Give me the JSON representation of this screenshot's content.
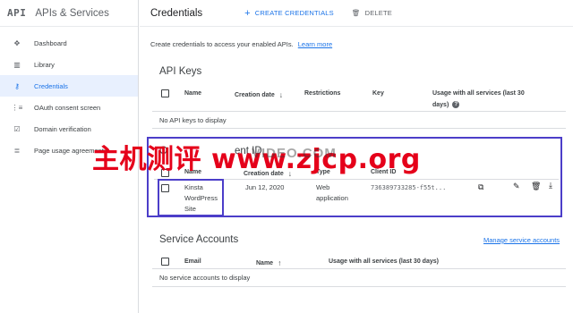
{
  "app": {
    "logo": "API",
    "title": "APIs & Services"
  },
  "sidebar": {
    "items": [
      {
        "label": "Dashboard",
        "icon": "diamond-dots-icon"
      },
      {
        "label": "Library",
        "icon": "library-grid-icon"
      },
      {
        "label": "Credentials",
        "icon": "key-icon",
        "active": true
      },
      {
        "label": "OAuth consent screen",
        "icon": "consent-list-icon"
      },
      {
        "label": "Domain verification",
        "icon": "checkbox-verify-icon"
      },
      {
        "label": "Page usage agreements",
        "icon": "settings-list-icon"
      }
    ]
  },
  "header": {
    "title": "Credentials",
    "create_label": "CREATE CREDENTIALS",
    "delete_label": "DELETE"
  },
  "intro": {
    "text": "Create credentials to access your enabled APIs.",
    "link": "Learn more"
  },
  "api_keys": {
    "title": "API Keys",
    "columns": {
      "name": "Name",
      "creation_date": "Creation date",
      "restrictions": "Restrictions",
      "key": "Key",
      "usage_line1": "Usage with all services (last 30",
      "usage_line2": "days)"
    },
    "empty": "No API keys to display"
  },
  "oauth": {
    "title_visible": "O",
    "title_tail": "ent ID",
    "columns": {
      "name": "Name",
      "creation_date": "Creation date",
      "type": "Type",
      "client_id": "Client ID"
    },
    "rows": [
      {
        "name_lines": [
          "Kinsta",
          "WordPress",
          "Site"
        ],
        "creation_date": "Jun 12, 2020",
        "type_lines": [
          "Web",
          "application"
        ],
        "client_id": "736389733285-f55t..."
      }
    ]
  },
  "service_accounts": {
    "title": "Service Accounts",
    "manage_link": "Manage service accounts",
    "columns": {
      "email": "Email",
      "name": "Name",
      "usage": "Usage with all services (last 30 days)"
    },
    "empty": "No service accounts to display"
  },
  "watermark": {
    "main": "主机测评 www.zjcp.org",
    "sub": "VIDEO.COM"
  },
  "colors": {
    "accent": "#1a73e8",
    "outline": "#4c3ec9",
    "watermark": "#e5001a"
  }
}
